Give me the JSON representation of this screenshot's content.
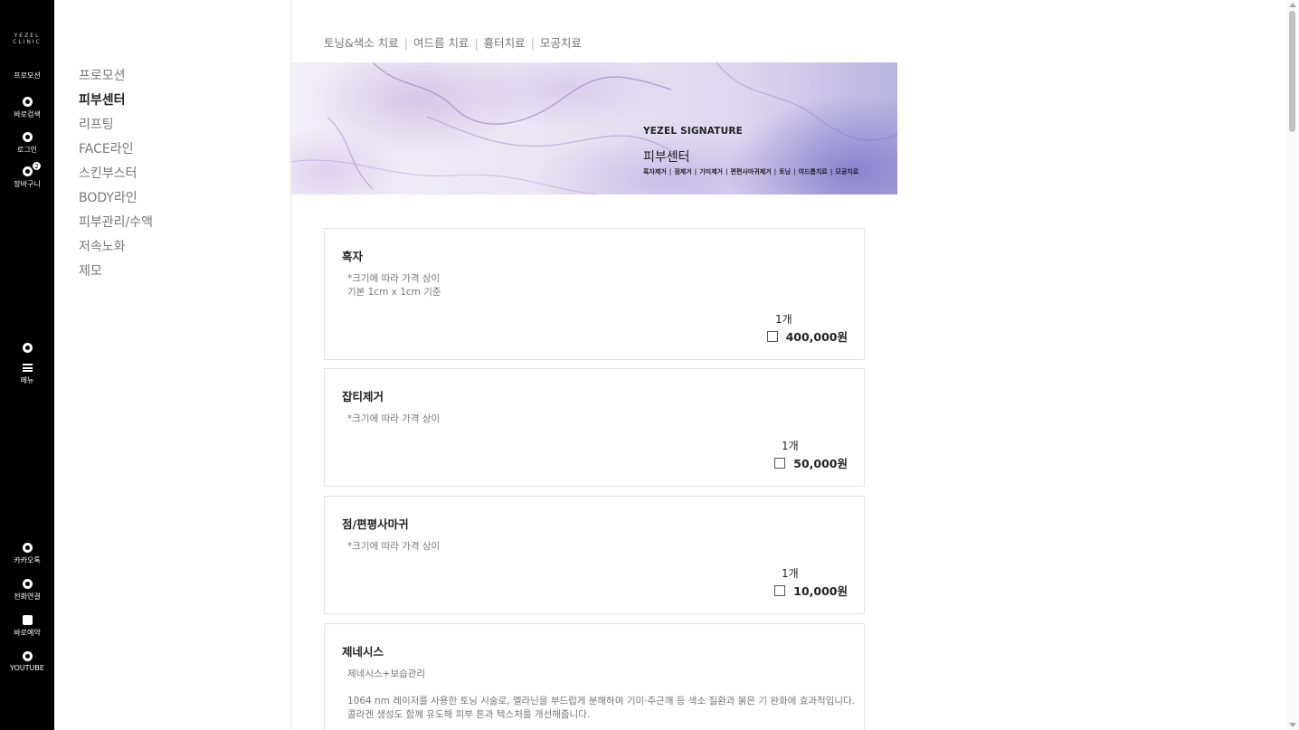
{
  "rail": {
    "logo": "YEZEL\nCLINIC",
    "promotion": "프로모션",
    "search": "바로검색",
    "login": "로그인",
    "cart": "장바구니",
    "cart_count": "2",
    "menu": "메뉴",
    "kakao": "카카오톡",
    "call": "전화연결",
    "booking": "바로예약",
    "youtube": "YOUTUBE"
  },
  "categories": [
    "프로모션",
    "피부센터",
    "리프팅",
    "FACE라인",
    "스킨부스터",
    "BODY라인",
    "피부관리/수액",
    "저속노화",
    "제모"
  ],
  "active_category": "피부센터",
  "subtabs": [
    "토닝&색소 치료",
    "여드름 치료",
    "흉터치료",
    "모공치료"
  ],
  "banner": {
    "brand": "YEZEL SIGNATURE",
    "title": "피부센터",
    "links": [
      "흑자제거",
      "점제거",
      "기미제거",
      "편편사마귀제거",
      "토닝",
      "여드름치료",
      "모공치료"
    ]
  },
  "cards": [
    {
      "title": "흑자",
      "desc": [
        "*크기에 따라 가격 상이",
        "기본 1cm x 1cm 기준"
      ],
      "qty": "1개",
      "price": "400,000원"
    },
    {
      "title": "잡티제거",
      "desc": [
        "*크기에 따라 가격 상이"
      ],
      "qty": "1개",
      "price": "50,000원"
    },
    {
      "title": "점/편평사마귀",
      "desc": [
        "*크기에 따라 가격 상이"
      ],
      "qty": "1개",
      "price": "10,000원"
    },
    {
      "title": "제네시스",
      "desc": [
        "제네시스+보습관리",
        "1064 nm 레이저를 사용한 토닝 시술로, 멜라닌을 부드럽게 분해하며 기미·주근깨 등 색소 질환과 붉은 기 완화에 효과적입니다.",
        "콜라겐 생성도 함께 유도해 피부 톤과 텍스처를 개선해줍니다."
      ]
    }
  ]
}
